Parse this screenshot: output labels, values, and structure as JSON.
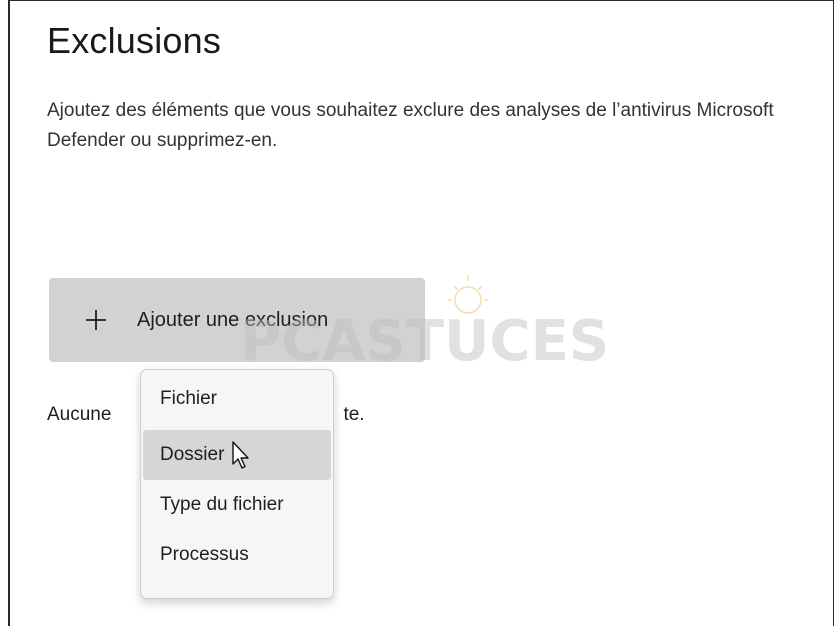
{
  "page": {
    "title": "Exclusions",
    "description": "Ajoutez des éléments que vous souhaitez exclure des analyses de l’antivirus Microsoft Defender ou supprimez-en.",
    "add_button": {
      "icon": "plus-icon",
      "label": "Ajouter une exclusion"
    },
    "empty_text_left": "Aucune",
    "empty_text_right": "te."
  },
  "menu": {
    "items": [
      {
        "label": "Fichier"
      },
      {
        "label": "Dossier",
        "state": "hover"
      },
      {
        "label": "Type du fichier"
      },
      {
        "label": "Processus"
      }
    ]
  },
  "watermark": {
    "text": "PCASTUCES"
  },
  "colors": {
    "button_bg": "#d2d2d2",
    "menu_bg": "#f6f6f6",
    "menu_hover": "#d6d6d6",
    "text": "#1f1f1f"
  }
}
